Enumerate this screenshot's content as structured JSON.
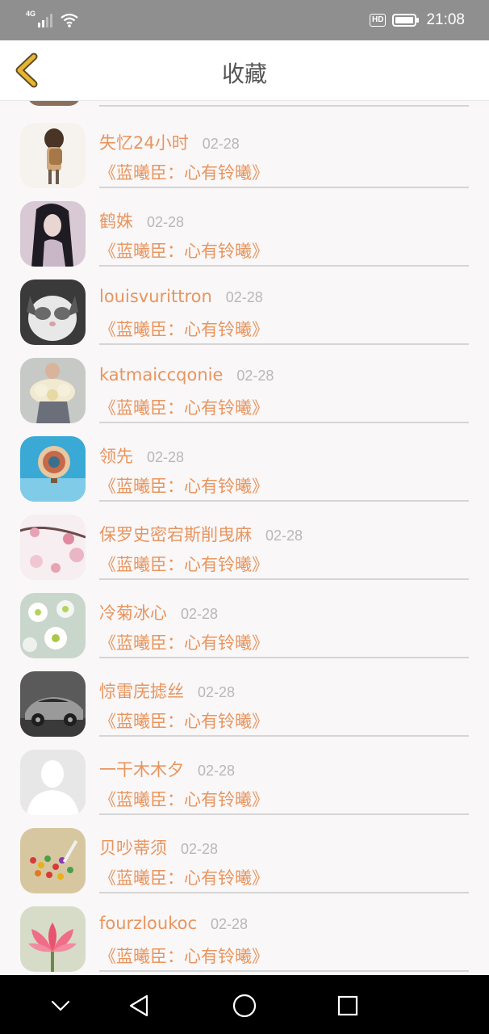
{
  "status_bar": {
    "network": "4G",
    "hd": "HD",
    "time": "21:08"
  },
  "header": {
    "title": "收藏"
  },
  "colors": {
    "accent": "#e8955e",
    "date": "#b8b8b8",
    "back_arrow": "#e8b52e",
    "status_bar_bg": "#8f8f8f"
  },
  "items": [
    {
      "name": "失忆24小时",
      "date": "02-28",
      "book": "《蓝曦臣：心有铃曦》"
    },
    {
      "name": "鹤姝",
      "date": "02-28",
      "book": "《蓝曦臣：心有铃曦》"
    },
    {
      "name": "louisvurittron",
      "date": "02-28",
      "book": "《蓝曦臣：心有铃曦》"
    },
    {
      "name": "katmaiccqonie",
      "date": "02-28",
      "book": "《蓝曦臣：心有铃曦》"
    },
    {
      "name": "领先",
      "date": "02-28",
      "book": "《蓝曦臣：心有铃曦》"
    },
    {
      "name": "保罗史密宕斯削曳麻",
      "date": "02-28",
      "book": "《蓝曦臣：心有铃曦》"
    },
    {
      "name": "冷菊冰心",
      "date": "02-28",
      "book": "《蓝曦臣：心有铃曦》"
    },
    {
      "name": "惊雷庑摅丝",
      "date": "02-28",
      "book": "《蓝曦臣：心有铃曦》"
    },
    {
      "name": "一干木木夕",
      "date": "02-28",
      "book": "《蓝曦臣：心有铃曦》"
    },
    {
      "name": "贝吵蒂须",
      "date": "02-28",
      "book": "《蓝曦臣：心有铃曦》"
    },
    {
      "name": "fourzloukoc",
      "date": "02-28",
      "book": "《蓝曦臣：心有铃曦》"
    }
  ],
  "avatar_icons": [
    "girl-backpack-avatar",
    "long-hair-girl-avatar",
    "cat-avatar",
    "flower-dress-avatar",
    "balloon-avatar",
    "plum-blossom-avatar",
    "daisy-avatar",
    "sports-car-avatar",
    "default-person-avatar",
    "candy-avatar",
    "pink-lotus-avatar"
  ],
  "nav_icons": [
    "chevron-down-icon",
    "back-triangle-icon",
    "home-circle-icon",
    "recents-square-icon"
  ]
}
